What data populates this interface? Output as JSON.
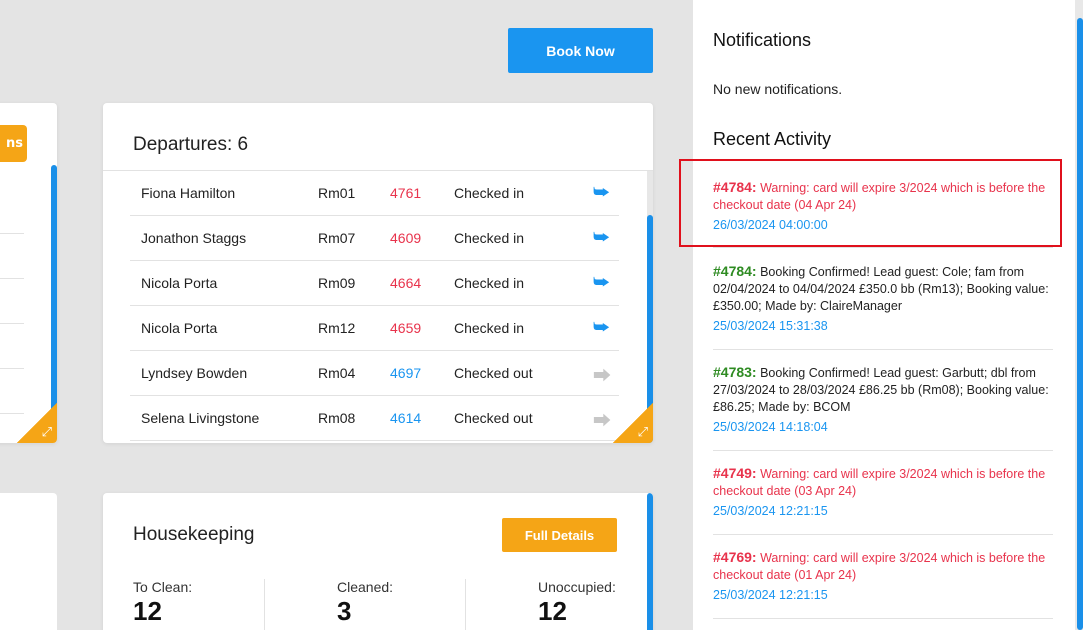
{
  "left_card": {
    "button_label": "ns"
  },
  "toolbar": {
    "book_now_label": "Book Now"
  },
  "departures": {
    "title": "Departures: 6",
    "rows": [
      {
        "name": "Fiona Hamilton",
        "room": "Rm01",
        "id": "4761",
        "status": "Checked in",
        "state": "in"
      },
      {
        "name": "Jonathon Staggs",
        "room": "Rm07",
        "id": "4609",
        "status": "Checked in",
        "state": "in"
      },
      {
        "name": "Nicola Porta",
        "room": "Rm09",
        "id": "4664",
        "status": "Checked in",
        "state": "in"
      },
      {
        "name": "Nicola Porta",
        "room": "Rm12",
        "id": "4659",
        "status": "Checked in",
        "state": "in"
      },
      {
        "name": "Lyndsey Bowden",
        "room": "Rm04",
        "id": "4697",
        "status": "Checked out",
        "state": "out"
      },
      {
        "name": "Selena Livingstone",
        "room": "Rm08",
        "id": "4614",
        "status": "Checked out",
        "state": "out"
      }
    ],
    "icons": {
      "checked_in": "sign-out-icon",
      "checked_out": "sign-in-icon",
      "expand": "expand-icon"
    }
  },
  "housekeeping": {
    "title": "Housekeeping",
    "full_details_label": "Full Details",
    "stats": [
      {
        "label": "To Clean:",
        "value": "12"
      },
      {
        "label": "Cleaned:",
        "value": "3"
      },
      {
        "label": "Unoccupied:",
        "value": "12"
      }
    ]
  },
  "notifications": {
    "title": "Notifications",
    "empty_text": "No new notifications."
  },
  "recent_activity": {
    "title": "Recent Activity",
    "items": [
      {
        "ref": "#4784:",
        "message": "Warning: card will expire 3/2024 which is before the checkout date (04 Apr 24)",
        "timestamp": "26/03/2024 04:00:00",
        "type": "warning"
      },
      {
        "ref": "#4784:",
        "message": "Booking Confirmed! Lead guest: Cole; fam from 02/04/2024 to 04/04/2024 £350.0 bb (Rm13); Booking value: £350.00; Made by: ClaireManager",
        "timestamp": "25/03/2024 15:31:38",
        "type": "confirmed"
      },
      {
        "ref": "#4783:",
        "message": "Booking Confirmed! Lead guest: Garbutt; dbl from 27/03/2024 to 28/03/2024 £86.25 bb (Rm08); Booking value: £86.25; Made by: BCOM",
        "timestamp": "25/03/2024 14:18:04",
        "type": "confirmed"
      },
      {
        "ref": "#4749:",
        "message": "Warning: card will expire 3/2024 which is before the checkout date (03 Apr 24)",
        "timestamp": "25/03/2024 12:21:15",
        "type": "warning"
      },
      {
        "ref": "#4769:",
        "message": "Warning: card will expire 3/2024 which is before the checkout date (01 Apr 24)",
        "timestamp": "25/03/2024 12:21:15",
        "type": "warning"
      }
    ]
  },
  "colors": {
    "accent_blue": "#1a95f0",
    "accent_orange": "#f5a516",
    "warning_red": "#e8334c",
    "confirmed_green": "#2e8b22",
    "highlight_red": "#e0101c"
  }
}
